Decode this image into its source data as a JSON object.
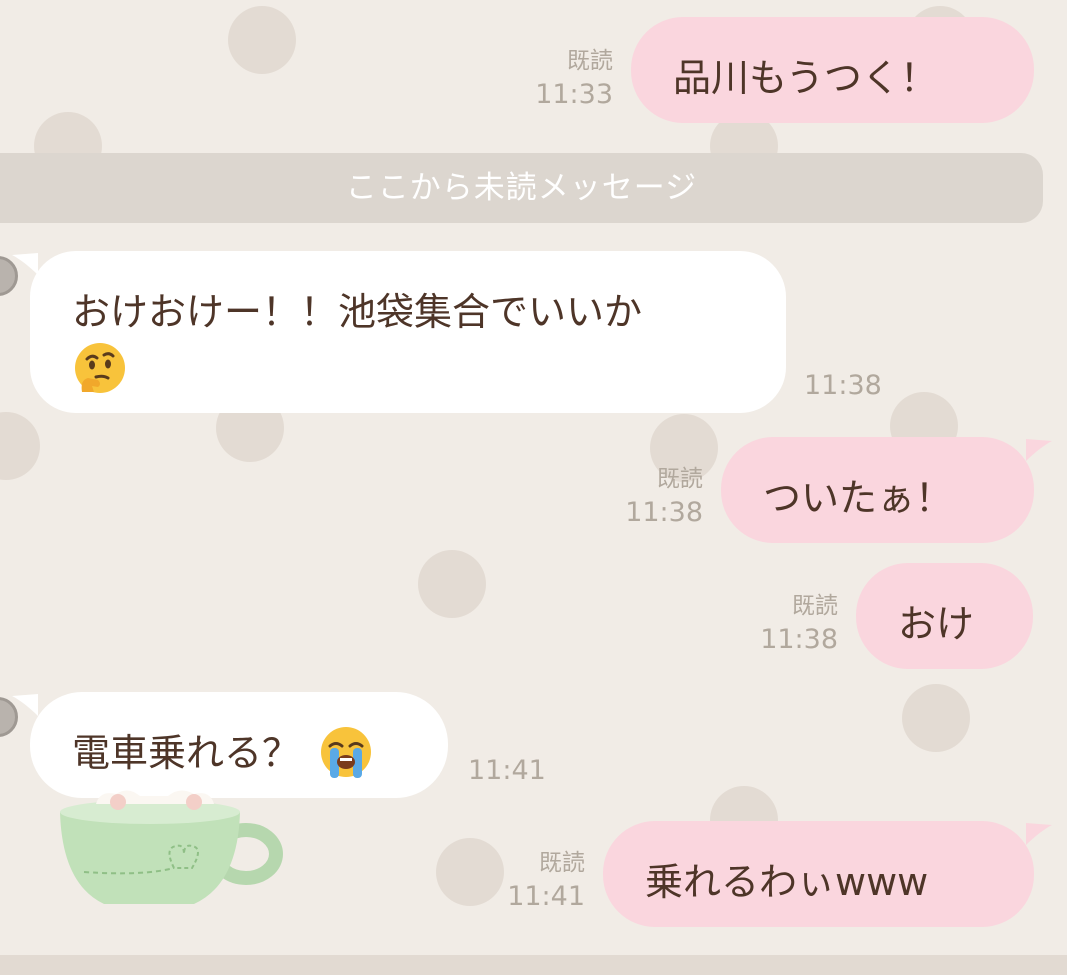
{
  "divider": {
    "label": "ここから未読メッセージ"
  },
  "messages": [
    {
      "id": "m1",
      "side": "out",
      "text": "品川もうつく！",
      "read": "既読",
      "time": "11:33"
    },
    {
      "id": "m2",
      "side": "in",
      "text_line1": "おけおけー！！池袋集合でいいか",
      "emoji": "thinking-face-emoji",
      "time": "11:38"
    },
    {
      "id": "m3",
      "side": "out",
      "text": "ついたぁ！",
      "read": "既読",
      "time": "11:38"
    },
    {
      "id": "m4",
      "side": "out",
      "text": "おけ",
      "read": "既読",
      "time": "11:38"
    },
    {
      "id": "m5",
      "side": "in",
      "text": "電車乗れる？",
      "emoji": "loudly-crying-face-emoji",
      "time": "11:41"
    },
    {
      "id": "m6",
      "side": "out",
      "text": "乗れるわぃwww",
      "read": "既読",
      "time": "11:41"
    }
  ],
  "sticker": {
    "icon": "teacup-sticker"
  },
  "colors": {
    "background": "#f1ece6",
    "dots": "#e3dbd3",
    "outgoing_bubble": "#fad6de",
    "incoming_bubble": "#ffffff",
    "message_text": "#4e3528",
    "meta_text": "#b1a89d",
    "divider_bg": "#dcd6cf"
  }
}
